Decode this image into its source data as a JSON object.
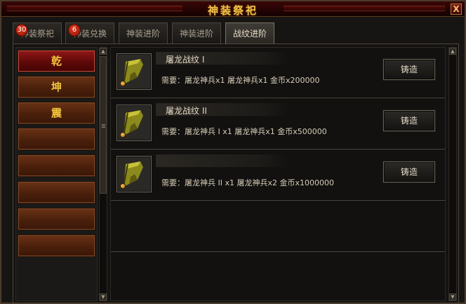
{
  "window": {
    "title": "神装祭祀",
    "close_label": "X"
  },
  "tabs": [
    {
      "label": "神装祭祀",
      "badge": "30",
      "active": false
    },
    {
      "label": "神装兑换",
      "badge": "6",
      "active": false
    },
    {
      "label": "神装进阶",
      "badge": null,
      "active": false
    },
    {
      "label": "神装进阶",
      "badge": null,
      "active": false
    },
    {
      "label": "战纹进阶",
      "badge": null,
      "active": true
    }
  ],
  "trigrams": [
    {
      "label": "乾",
      "selected": true
    },
    {
      "label": "坤",
      "selected": false
    },
    {
      "label": "震",
      "selected": false
    },
    {
      "label": "",
      "selected": false
    },
    {
      "label": "",
      "selected": false
    },
    {
      "label": "",
      "selected": false
    },
    {
      "label": "",
      "selected": false
    },
    {
      "label": "",
      "selected": false
    }
  ],
  "items": [
    {
      "name": "屠龙战纹 I",
      "requirement": "需要：屠龙神兵x1  屠龙神兵x1  金币x200000",
      "button": "铸造"
    },
    {
      "name": "屠龙战纹 II",
      "requirement": "需要：屠龙神兵 I x1  屠龙神兵x1  金币x500000",
      "button": "铸造"
    },
    {
      "name": "",
      "requirement": "需要：屠龙神兵 II x1  屠龙神兵x2  金币x1000000",
      "button": "铸造"
    }
  ],
  "scroll": {
    "up": "▲",
    "down": "▼"
  },
  "colors": {
    "title_gold": "#f2c24a",
    "trigram_gold": "#f2c43c",
    "selected_red": "#901818",
    "badge_red": "#e23a1c"
  }
}
